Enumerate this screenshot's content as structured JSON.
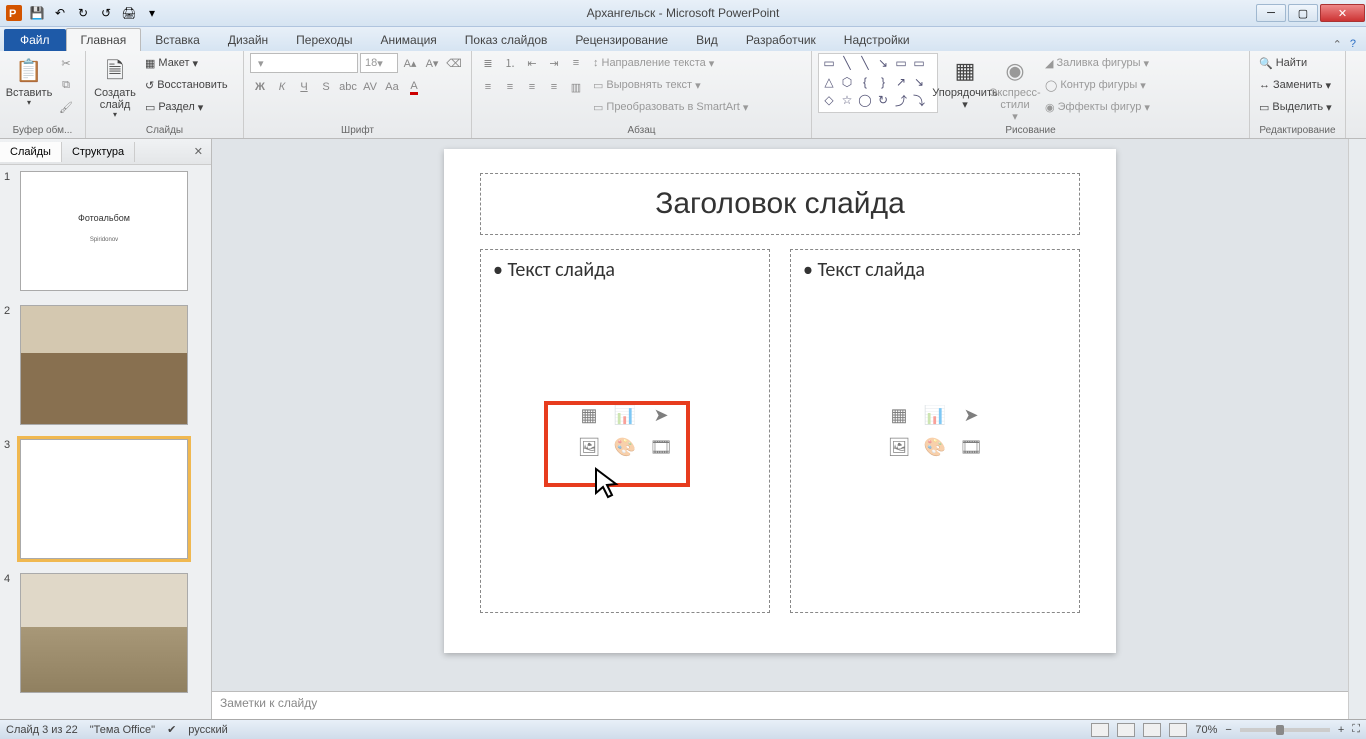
{
  "app": {
    "title": "Архангельск - Microsoft PowerPoint"
  },
  "tabs": {
    "file": "Файл",
    "items": [
      "Главная",
      "Вставка",
      "Дизайн",
      "Переходы",
      "Анимация",
      "Показ слайдов",
      "Рецензирование",
      "Вид",
      "Разработчик",
      "Надстройки"
    ],
    "active_index": 0
  },
  "ribbon": {
    "clipboard": {
      "label": "Буфер обм...",
      "paste": "Вставить"
    },
    "slides": {
      "label": "Слайды",
      "new": "Создать слайд",
      "layout": "Макет",
      "reset": "Восстановить",
      "section": "Раздел"
    },
    "font": {
      "label": "Шрифт",
      "name_placeholder": "",
      "size": "18"
    },
    "paragraph": {
      "label": "Абзац",
      "text_dir": "Направление текста",
      "align": "Выровнять текст",
      "smartart": "Преобразовать в SmartArt"
    },
    "drawing": {
      "label": "Рисование",
      "arrange": "Упорядочить",
      "quick": "Экспресс-стили",
      "fill": "Заливка фигуры",
      "outline": "Контур фигуры",
      "effects": "Эффекты фигур"
    },
    "editing": {
      "label": "Редактирование",
      "find": "Найти",
      "replace": "Заменить",
      "select": "Выделить"
    }
  },
  "panel": {
    "tab_slides": "Слайды",
    "tab_outline": "Структура",
    "thumbs": [
      {
        "n": "1",
        "title": "Фотоальбом",
        "sub": "Spiridonov"
      },
      {
        "n": "2"
      },
      {
        "n": "3"
      },
      {
        "n": "4"
      }
    ],
    "selected": 2
  },
  "slide": {
    "title": "Заголовок слайда",
    "content_left": "Текст слайда",
    "content_right": "Текст слайда"
  },
  "notes": {
    "placeholder": "Заметки к слайду"
  },
  "status": {
    "slide_info": "Слайд 3 из 22",
    "theme": "\"Тема Office\"",
    "lang": "русский",
    "zoom": "70%"
  }
}
